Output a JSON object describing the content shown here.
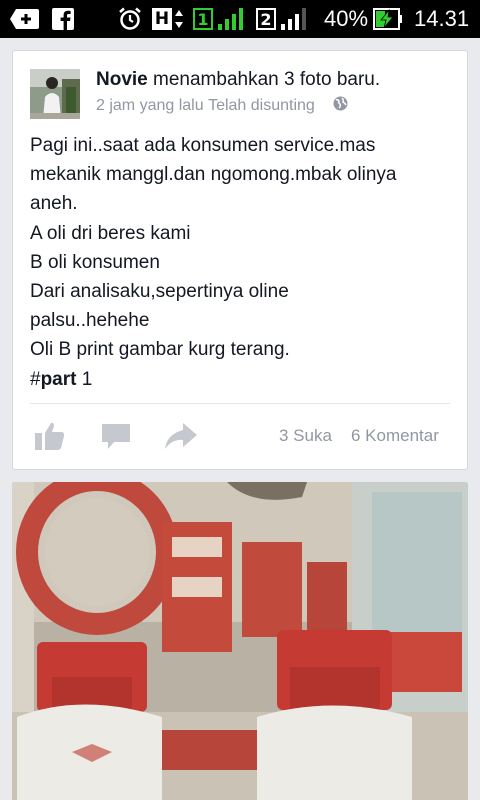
{
  "status_bar": {
    "icons": [
      "add-icon",
      "facebook-icon",
      "alarm-icon",
      "hspa-icon",
      "sim1-signal-icon",
      "sim2-signal-icon",
      "battery-charging-icon"
    ],
    "network_type": "H",
    "sim1_label": "1",
    "sim2_label": "2",
    "battery_percent": "40%",
    "time": "14.31",
    "accent_color": "#33cc33"
  },
  "post": {
    "author": "Novie",
    "action": "menambahkan 3 foto baru.",
    "time_ago": "2 jam yang lalu",
    "edited": "Telah disunting",
    "privacy_icon": "globe-icon",
    "lines": [
      "Pagi ini..saat ada konsumen service.mas",
      "mekanik manggl.dan ngomong.mbak olinya",
      "aneh.",
      "A oli dri beres kami",
      "B oli konsumen",
      "Dari analisaku,sepertinya oline",
      "palsu..hehehe",
      "Oli B print gambar kurg terang."
    ],
    "hashtag_symbol": "#",
    "hashtag_word": "part",
    "hashtag_suffix": " 1",
    "likes": "3 Suka",
    "comments": "6 Komentar",
    "actions": [
      "like-icon",
      "comment-icon",
      "share-icon"
    ]
  },
  "photo": {
    "description_icon": "photo-image"
  }
}
